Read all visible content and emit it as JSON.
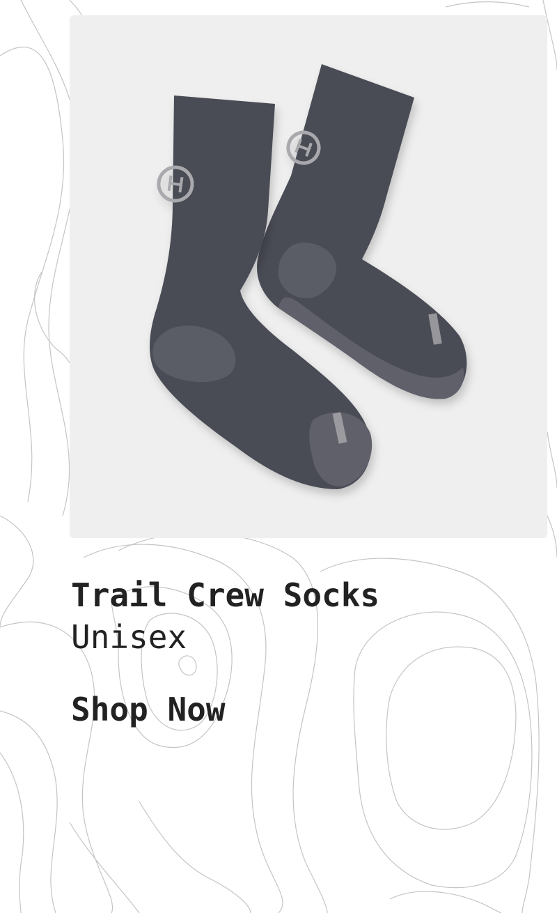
{
  "product": {
    "name": "Trail Crew Socks",
    "variant": "Unisex",
    "image_alt": "Pair of dark grey crew socks"
  },
  "cta": {
    "label": "Shop Now"
  },
  "colors": {
    "text": "#222222",
    "image_background": "#efefef",
    "sock_body": "#4a4c55",
    "sock_accent": "#5e606a",
    "logo": "#a9a9ad",
    "topo_lines": "#c4c4c4"
  }
}
